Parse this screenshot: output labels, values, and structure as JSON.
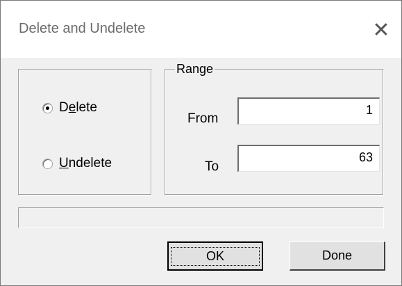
{
  "window": {
    "title": "Delete and Undelete",
    "close_glyph": "✕"
  },
  "mode": {
    "options": [
      {
        "pre": "D",
        "accel": "e",
        "post": "lete",
        "selected": true
      },
      {
        "pre": "",
        "accel": "U",
        "post": "ndelete",
        "selected": false
      }
    ]
  },
  "range": {
    "legend": "Range",
    "from_label": "From",
    "from_value": "1",
    "to_label": "To",
    "to_value": "63"
  },
  "buttons": {
    "ok_label": "OK",
    "done_label": "Done"
  }
}
